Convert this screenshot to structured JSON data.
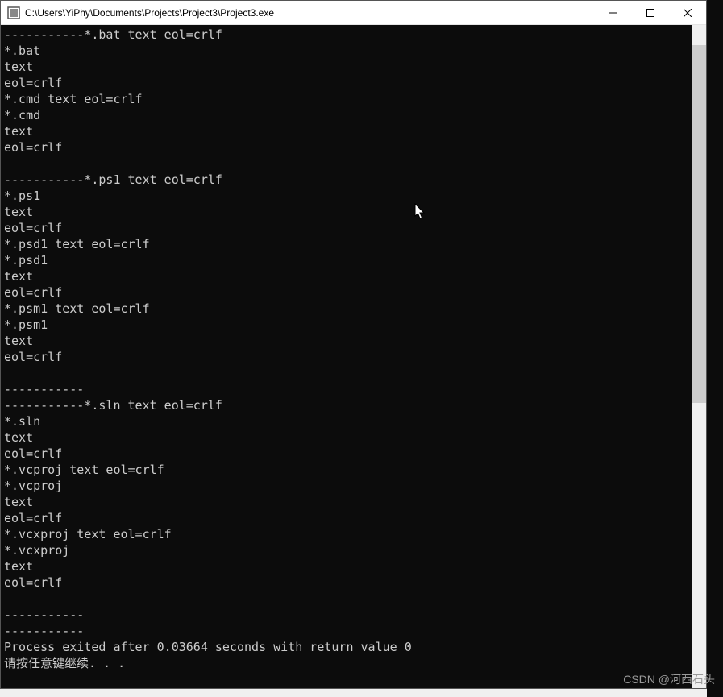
{
  "window": {
    "title": "C:\\Users\\YiPhy\\Documents\\Projects\\Project3\\Project3.exe"
  },
  "console": {
    "lines": [
      "-----------*.bat text eol=crlf",
      "*.bat",
      "text",
      "eol=crlf",
      "*.cmd text eol=crlf",
      "*.cmd",
      "text",
      "eol=crlf",
      "",
      "-----------*.ps1 text eol=crlf",
      "*.ps1",
      "text",
      "eol=crlf",
      "*.psd1 text eol=crlf",
      "*.psd1",
      "text",
      "eol=crlf",
      "*.psm1 text eol=crlf",
      "*.psm1",
      "text",
      "eol=crlf",
      "",
      "-----------",
      "-----------*.sln text eol=crlf",
      "*.sln",
      "text",
      "eol=crlf",
      "*.vcproj text eol=crlf",
      "*.vcproj",
      "text",
      "eol=crlf",
      "*.vcxproj text eol=crlf",
      "*.vcxproj",
      "text",
      "eol=crlf",
      "",
      "-----------",
      "-----------",
      "Process exited after 0.03664 seconds with return value 0",
      "请按任意键继续. . ."
    ]
  },
  "scrollbar": {
    "thumb_top_pct": 3,
    "thumb_height_pct": 54
  },
  "watermark": "CSDN @河西石头"
}
